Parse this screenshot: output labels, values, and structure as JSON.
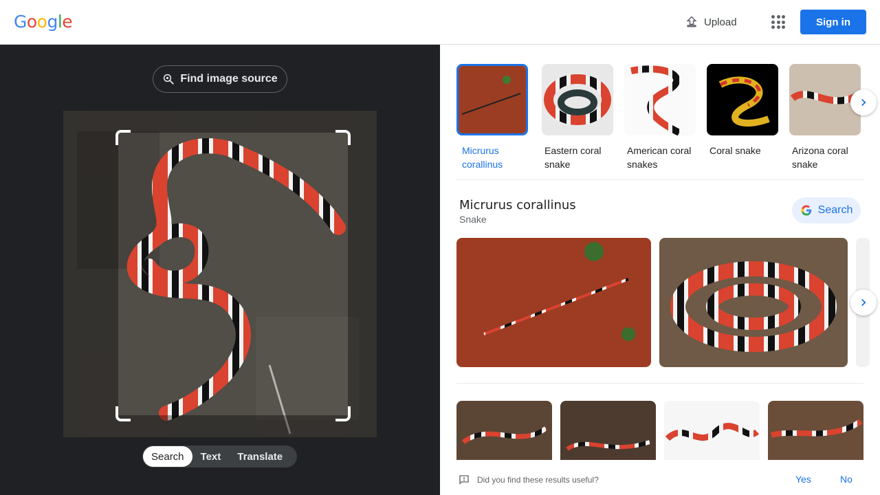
{
  "header": {
    "logo_letters": [
      "G",
      "o",
      "o",
      "g",
      "l",
      "e"
    ],
    "logo_colors": [
      "#4285F4",
      "#EA4335",
      "#FBBC05",
      "#4285F4",
      "#34A853",
      "#EA4335"
    ],
    "upload_label": "Upload",
    "signin_label": "Sign in"
  },
  "lens": {
    "find_source_label": "Find image source",
    "modes": [
      {
        "label": "Search",
        "active": true
      },
      {
        "label": "Text",
        "active": false
      },
      {
        "label": "Translate",
        "active": false
      }
    ]
  },
  "results": {
    "chips": [
      {
        "label": "Micrurus corallinus",
        "selected": true
      },
      {
        "label": "Eastern coral snake",
        "selected": false
      },
      {
        "label": "American coral snakes",
        "selected": false
      },
      {
        "label": "Coral snake",
        "selected": false
      },
      {
        "label": "Arizona coral snake",
        "selected": false
      }
    ],
    "entity": {
      "title": "Micrurus corallinus",
      "subtitle": "Snake",
      "search_label": "Search"
    },
    "feedback": {
      "question": "Did you find these results useful?",
      "yes": "Yes",
      "no": "No"
    }
  },
  "colors": {
    "accent": "#1a73e8",
    "dark_pane": "#202124"
  }
}
